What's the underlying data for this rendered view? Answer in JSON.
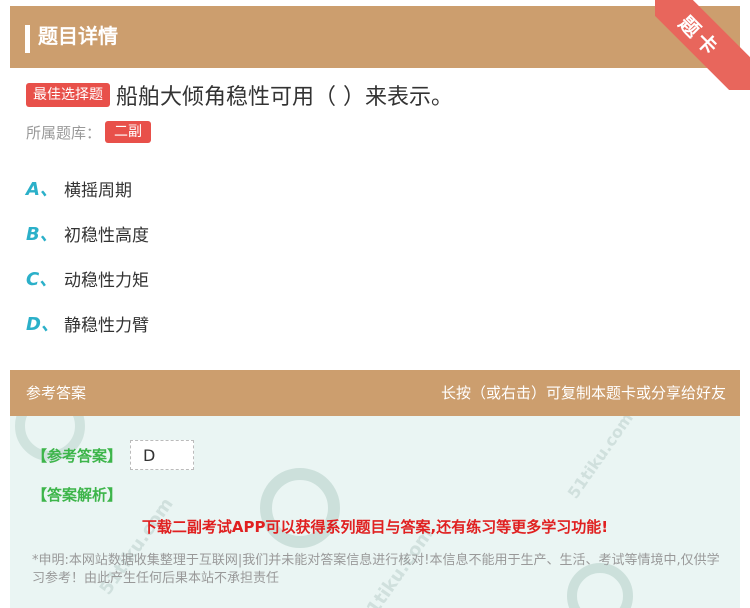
{
  "header": {
    "title": "题目详情",
    "corner_badge": "题卡"
  },
  "question": {
    "type_badge": "最佳选择题",
    "text": "船舶大倾角稳性可用（    ）来表示。",
    "bank_label": "所属题库：",
    "bank_tag": "二副"
  },
  "options": [
    {
      "letter": "A、",
      "text": "横摇周期"
    },
    {
      "letter": "B、",
      "text": "初稳性高度"
    },
    {
      "letter": "C、",
      "text": "动稳性力矩"
    },
    {
      "letter": "D、",
      "text": "静稳性力臂"
    }
  ],
  "answer_section": {
    "title": "参考答案",
    "hint": "长按（或右击）可复制本题卡或分享给好友",
    "ref_label": "【参考答案】",
    "ref_value": "D",
    "analysis_label": "【答案解析】",
    "download_text": "下载二副考试APP可以获得系列题目与答案,还有练习等更多学习功能!",
    "disclaimer": "*申明:本网站数据收集整理于互联网|我们并未能对答案信息进行核对!本信息不能用于生产、生活、考试等情境中,仅供学习参考！由此产生任何后果本站不承担责任"
  },
  "watermark": {
    "text": "51tiku.com"
  },
  "colors": {
    "header": "#cc9e6e",
    "accent_red": "#e8504a",
    "option_letter": "#2bb0c9",
    "answer_bg": "#eaf5f3",
    "green": "#3db54a"
  }
}
